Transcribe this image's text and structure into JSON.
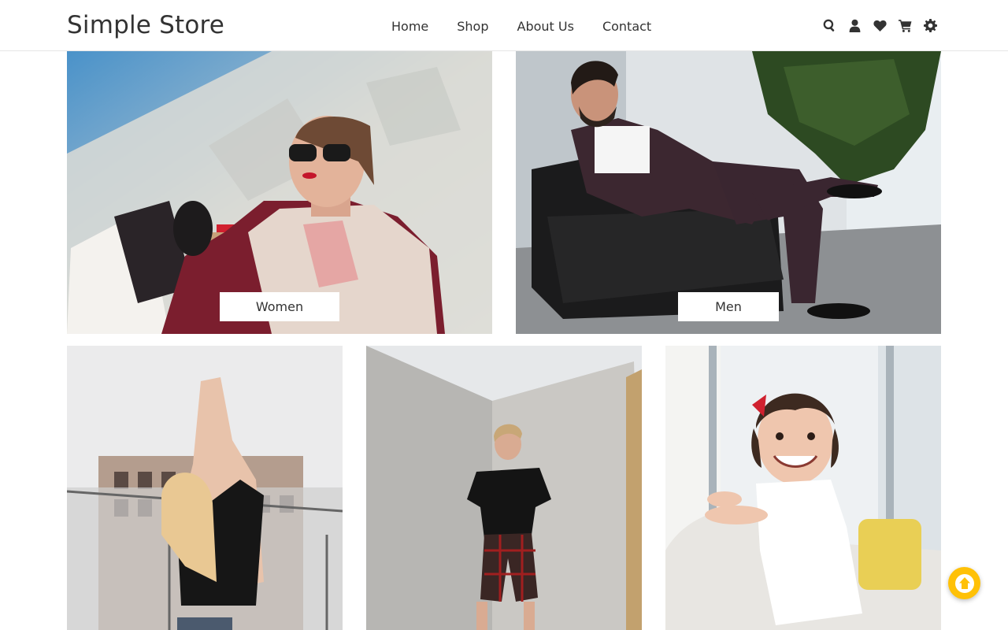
{
  "brand": {
    "name": "Simple Store"
  },
  "nav": {
    "items": [
      {
        "label": "Home"
      },
      {
        "label": "Shop"
      },
      {
        "label": "About Us"
      },
      {
        "label": "Contact"
      }
    ]
  },
  "header_icons": [
    "search-icon",
    "user-icon",
    "heart-icon",
    "cart-icon",
    "gear-icon"
  ],
  "categories": [
    {
      "label": "Women"
    },
    {
      "label": "Men"
    }
  ],
  "colors": {
    "accent": "#ffc107",
    "text": "#333333",
    "background": "#ffffff"
  }
}
